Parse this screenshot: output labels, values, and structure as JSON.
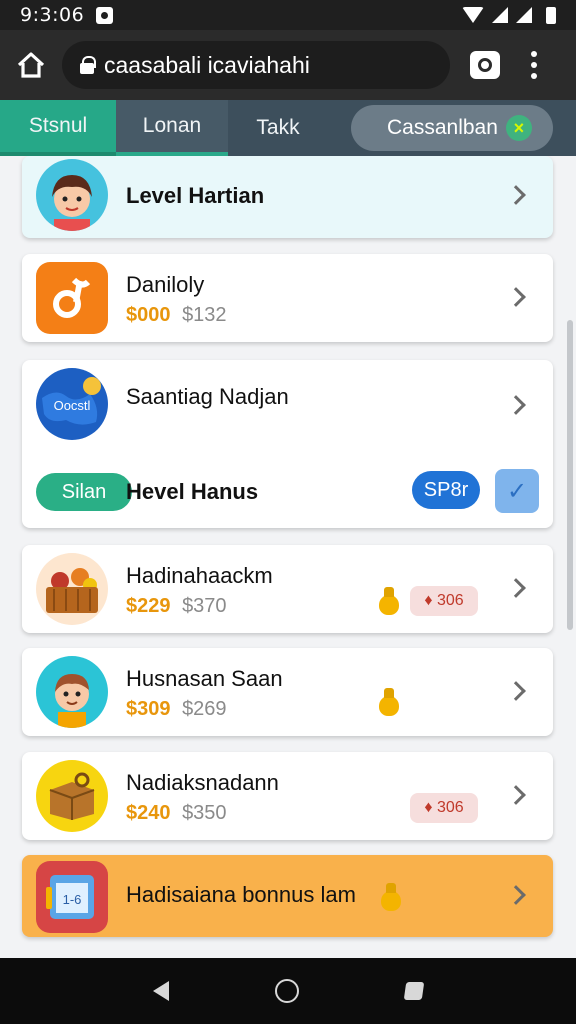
{
  "status_bar": {
    "time": "9:3:06"
  },
  "browser": {
    "url": "caasabali icaviahahi"
  },
  "tabs": [
    {
      "label": "Stsnul"
    },
    {
      "label": "Lonan"
    },
    {
      "label": "Takk"
    },
    {
      "label": "Cassanlban"
    }
  ],
  "list": {
    "item1": {
      "title": "Level Hartian"
    },
    "item2": {
      "title": "Daniloly",
      "price": "$000",
      "old_price": "$132"
    },
    "item3": {
      "title": "Saantiag Nadjan",
      "icon_label": "Oocstl",
      "tag": "Silan",
      "subtitle": "Hevel Hanus",
      "button": "SP8r"
    },
    "item4": {
      "title": "Hadinahaackm",
      "price": "$229",
      "old_price": "$370",
      "badge": "♦ 306"
    },
    "item5": {
      "title": "Husnasan Saan",
      "price": "$309",
      "old_price": "$269"
    },
    "item6": {
      "title": "Nadiaksnadann",
      "price": "$240",
      "old_price": "$350",
      "badge": "♦ 306"
    },
    "item7": {
      "title": "Hadisaiana bonnus lam",
      "icon_label": "1-6"
    }
  },
  "colors": {
    "accent": "#26a888",
    "price": "#e8960c",
    "promo": "#f9b14b",
    "tab_bar": "#3d4f5c"
  }
}
